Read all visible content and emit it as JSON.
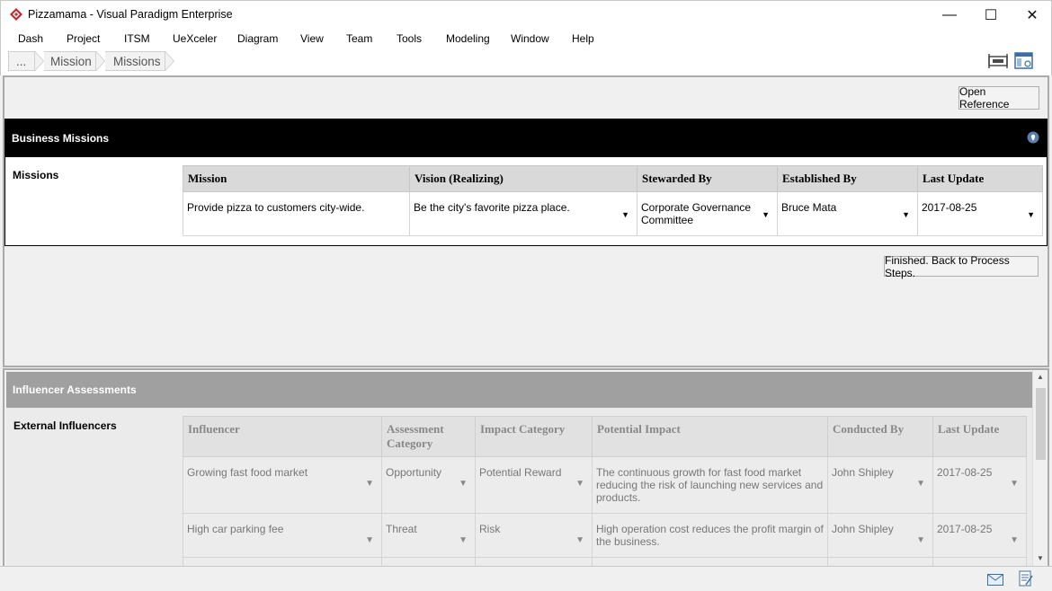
{
  "window": {
    "title": "Pizzamama - Visual Paradigm Enterprise",
    "minimize_glyph": "—",
    "maximize_glyph": "☐",
    "close_glyph": "✕"
  },
  "menu": [
    "Dash",
    "Project",
    "ITSM",
    "UeXceler",
    "Diagram",
    "View",
    "Team",
    "Tools",
    "Modeling",
    "Window",
    "Help"
  ],
  "breadcrumb": [
    "...",
    "Mission",
    "Missions"
  ],
  "open_reference": "Open Reference",
  "business_missions": {
    "title": "Business Missions",
    "section_label": "Missions",
    "columns": [
      "Mission",
      "Vision (Realizing)",
      "Stewarded By",
      "Established By",
      "Last Update"
    ],
    "rows": [
      [
        "Provide pizza to customers city-wide.",
        "Be the city's favorite pizza place.",
        "Corporate Governance Committee",
        "Bruce Mata",
        "2017-08-25"
      ]
    ]
  },
  "finished_button": "Finished. Back to Process Steps.",
  "influencer_assessments": {
    "title": "Influencer Assessments",
    "section_label": "External Influencers",
    "columns": [
      "Influencer",
      "Assessment Category",
      "Impact Category",
      "Potential Impact",
      "Conducted By",
      "Last Update"
    ],
    "rows": [
      [
        "Growing fast food market",
        "Opportunity",
        "Potential Reward",
        "The continuous growth for fast food market reducing the risk of launching new services and products.",
        "John Shipley",
        "2017-08-25"
      ],
      [
        "High car parking fee",
        "Threat",
        "Risk",
        "High operation cost reduces the profit margin of the business.",
        "John Shipley",
        "2017-08-25"
      ]
    ]
  },
  "icons": {
    "app": "visual-paradigm-logo-icon",
    "layout": "fit-layout-icon",
    "browser": "browser-window-icon",
    "pin": "location-pin-icon",
    "mail": "mail-icon",
    "notes": "notes-icon"
  },
  "colors": {
    "brand_red": "#c0282d",
    "header_black": "#000000",
    "ia_header_gray": "#a0a0a0"
  }
}
